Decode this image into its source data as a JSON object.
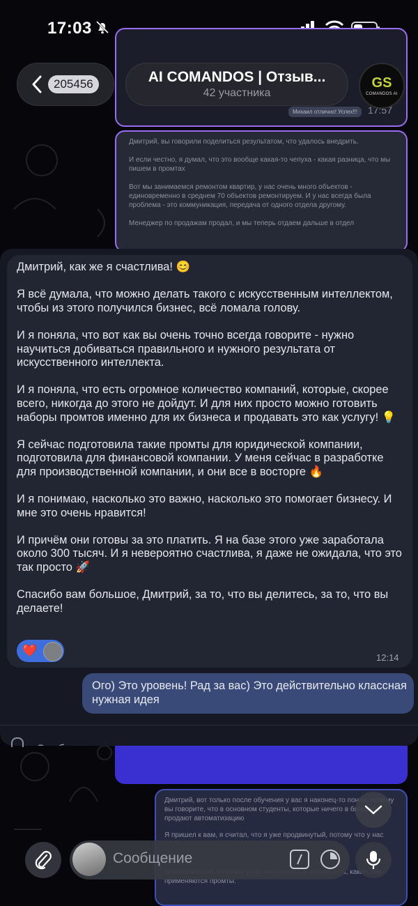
{
  "status_bar": {
    "time": "17:03"
  },
  "header": {
    "back_count": "205456",
    "title": "AI COMANDOS | Отзыв...",
    "subtitle": "42 участника",
    "logo_mark": "GS",
    "logo_caption": "COMANDOS AI"
  },
  "background_messages": {
    "top": {
      "quote": "Михаил отлично! Успех!!!",
      "time": "17:57"
    },
    "second": {
      "paragraphs": [
        "Дмитрий, вы говорили поделиться результатом, что удалось внедрить.",
        "И если честно, я думал, что это вообще какая-то чепуха - какая разница, что мы пишем в промтах",
        "Вот мы занимаемся ремонтом квартир, у нас очень много объектов - единовременно в среднем 70 объектов ремонтируем. И у нас всегда была проблема - это коммуникация, передача от одного отдела другому.",
        "Менеджер по продажам продал, и мы теперь отдаем дальше в отдел"
      ]
    },
    "bottom": {
      "paragraphs": [
        "Дмитрий, вот только после обучения у вас я наконец-то понял, почему вы говорите, что в основном студенты, которые ничего в бизнесе, продают автоматизацию",
        "Я пришел к вам, я считал, что я уже продвинутый, потому что у нас",
        "автоматизации, которые у нас настроены, и посмотреть, какие там применяются промты."
      ]
    }
  },
  "focused_message": {
    "paragraphs": [
      "Дмитрий, как же я счастлива! 😊",
      "Я всё думала, что можно делать такого с искусственным интеллектом, чтобы из этого получился бизнес, всё ломала голову.",
      "И я поняла, что вот как вы очень точно всегда говорите - нужно научиться добиваться правильного и нужного результата от искусственного интеллекта.",
      "И я поняла, что есть огромное количество компаний, которые, скорее всего, никогда до этого не дойдут. И для них просто можно готовить наборы промтов именно для их бизнеса и продавать это как услугу! 💡",
      "Я сейчас подготовила такие промты для юридической компании, подготовила для финансовой компании. У меня сейчас в разработке для производственной компании, и они все в восторге 🔥",
      "И я понимаю, насколько это важно, насколько это помогает бизнесу. И мне это очень нравится!",
      "И причём они готовы за это платить. Я на базе этого уже заработала около 300 тысяч. И я невероятно счастлива, я даже не ожидала, что это так просто 🚀",
      "Спасибо вам большое, Дмитрий, за то, что вы делитесь, за то, что вы делаете!"
    ],
    "reaction": "❤️",
    "time": "12:14"
  },
  "reply_message": {
    "text": "Ого) Это уровень! Рад за вас) Это действительно классная нужная идея"
  },
  "overlay_input_placeholder": "Сообщение",
  "composer": {
    "placeholder": "Сообщение"
  },
  "colors": {
    "incoming_bubble": "#222633",
    "outgoing_bubble": "#3a4a78",
    "accent_purple": "#9a6cf0",
    "reaction_bg": "#3d6edb"
  },
  "icons": [
    "bell-muted-icon",
    "signal-icon",
    "wifi-icon",
    "battery-icon",
    "chevron-left-icon",
    "paperclip-icon",
    "command-icon",
    "sticker-clock-icon",
    "microphone-icon",
    "chevron-down-icon"
  ]
}
